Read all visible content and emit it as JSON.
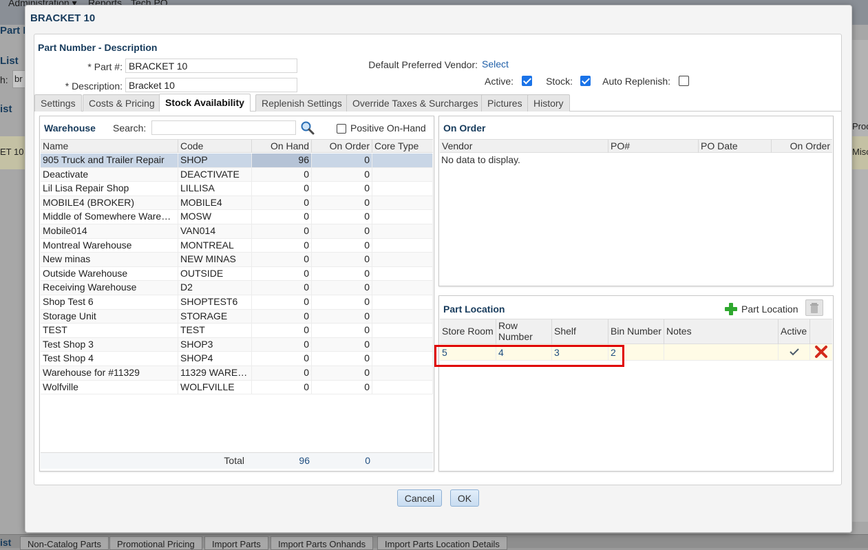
{
  "background": {
    "nav": [
      "Administration ▾",
      "Reports",
      "Tech PO"
    ],
    "page_title": "Part I",
    "list_title": "List",
    "search_label": "h:",
    "search_value": "br",
    "list_title_2": "ist",
    "row_text": "ET 10",
    "right_prod": "Prod",
    "right_misc": "Misc",
    "bottom_list": "ist",
    "bottom_tabs": [
      "Non-Catalog Parts",
      "Promotional Pricing",
      "Import Parts",
      "Import Parts Onhands",
      "Import Parts Location Details"
    ]
  },
  "dialog": {
    "title": "BRACKET 10",
    "section_title": "Part Number - Description",
    "part_label": "* Part #:",
    "part_value": "BRACKET 10",
    "desc_label": "* Description:",
    "desc_value": "Bracket 10",
    "vendor_label": "Default Preferred Vendor:",
    "vendor_link": "Select",
    "active_label": "Active:",
    "active": true,
    "stock_label": "Stock:",
    "stock": true,
    "auto_label": "Auto Replenish:",
    "auto": false,
    "tabs": [
      "Settings",
      "Costs & Pricing",
      "Stock Availability",
      "Replenish Settings",
      "Override Taxes & Surcharges",
      "Pictures",
      "History"
    ],
    "active_tab": "Stock Availability",
    "cancel": "Cancel",
    "ok": "OK"
  },
  "warehouse": {
    "title": "Warehouse",
    "search_label": "Search:",
    "search_placeholder": "",
    "positive_label": "Positive On-Hand",
    "positive": false,
    "columns": [
      "Name",
      "Code",
      "On Hand",
      "On Order",
      "Core Type"
    ],
    "rows": [
      {
        "name": "905 Truck and Trailer Repair",
        "code": "SHOP",
        "on_hand": "96",
        "on_order": "0",
        "core_type": ""
      },
      {
        "name": "Deactivate",
        "code": "DEACTIVATE",
        "on_hand": "0",
        "on_order": "0",
        "core_type": ""
      },
      {
        "name": "Lil Lisa Repair Shop",
        "code": "LILLISA",
        "on_hand": "0",
        "on_order": "0",
        "core_type": ""
      },
      {
        "name": "MOBILE4 (BROKER)",
        "code": "MOBILE4",
        "on_hand": "0",
        "on_order": "0",
        "core_type": ""
      },
      {
        "name": "Middle of Somewhere Wareho...",
        "code": "MOSW",
        "on_hand": "0",
        "on_order": "0",
        "core_type": ""
      },
      {
        "name": "Mobile014",
        "code": "VAN014",
        "on_hand": "0",
        "on_order": "0",
        "core_type": ""
      },
      {
        "name": "Montreal Warehouse",
        "code": "MONTREAL",
        "on_hand": "0",
        "on_order": "0",
        "core_type": ""
      },
      {
        "name": "New minas",
        "code": "NEW MINAS",
        "on_hand": "0",
        "on_order": "0",
        "core_type": ""
      },
      {
        "name": "Outside Warehouse",
        "code": "OUTSIDE",
        "on_hand": "0",
        "on_order": "0",
        "core_type": ""
      },
      {
        "name": "Receiving Warehouse",
        "code": "D2",
        "on_hand": "0",
        "on_order": "0",
        "core_type": ""
      },
      {
        "name": "Shop Test 6",
        "code": "SHOPTEST6",
        "on_hand": "0",
        "on_order": "0",
        "core_type": ""
      },
      {
        "name": "Storage Unit",
        "code": "STORAGE",
        "on_hand": "0",
        "on_order": "0",
        "core_type": ""
      },
      {
        "name": "TEST",
        "code": "TEST",
        "on_hand": "0",
        "on_order": "0",
        "core_type": ""
      },
      {
        "name": "Test Shop 3",
        "code": "SHOP3",
        "on_hand": "0",
        "on_order": "0",
        "core_type": ""
      },
      {
        "name": "Test Shop 4",
        "code": "SHOP4",
        "on_hand": "0",
        "on_order": "0",
        "core_type": ""
      },
      {
        "name": "Warehouse for #11329",
        "code": "11329 WAREHO",
        "on_hand": "0",
        "on_order": "0",
        "core_type": ""
      },
      {
        "name": "Wolfville",
        "code": "WOLFVILLE",
        "on_hand": "0",
        "on_order": "0",
        "core_type": ""
      }
    ],
    "total_label": "Total",
    "total_on_hand": "96",
    "total_on_order": "0"
  },
  "on_order": {
    "title": "On Order",
    "columns": [
      "Vendor",
      "PO#",
      "PO Date",
      "On Order"
    ],
    "empty_text": "No data to display."
  },
  "part_location": {
    "title": "Part Location",
    "add_label": "Part Location",
    "columns": [
      "Store Room",
      "Row Number",
      "Shelf",
      "Bin Number",
      "Notes",
      "Active"
    ],
    "rows": [
      {
        "store_room": "5",
        "row_number": "4",
        "shelf": "3",
        "bin_number": "2",
        "notes": "",
        "active": true
      }
    ]
  },
  "colors": {
    "accent": "#173b5c",
    "link": "#1f5fa8",
    "selected_row": "#c9d6e6",
    "highlight": "#e00000",
    "checkbox": "#1a73e8"
  }
}
